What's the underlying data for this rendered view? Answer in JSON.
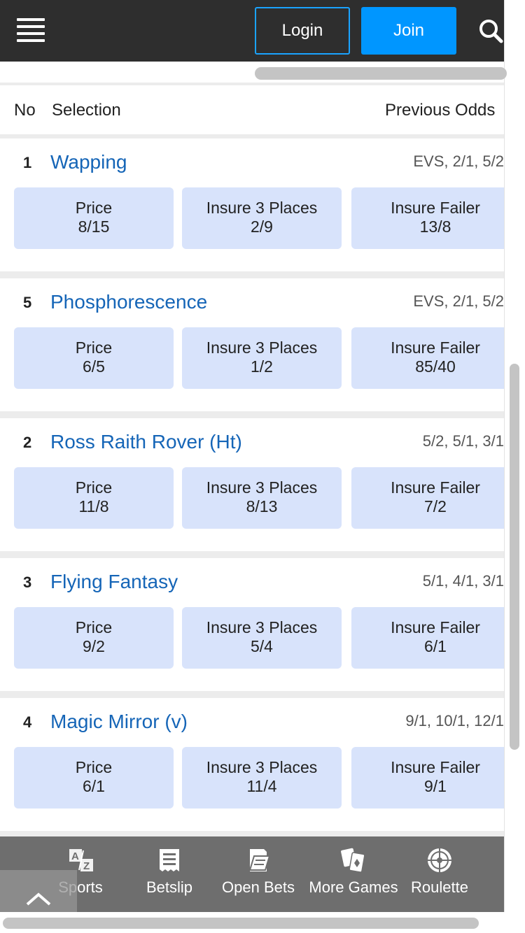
{
  "header": {
    "login_label": "Login",
    "join_label": "Join",
    "icons": {
      "menu": "hamburger-menu-icon",
      "search": "search-icon"
    }
  },
  "columns": {
    "no": "No",
    "selection": "Selection",
    "previous_odds": "Previous Odds"
  },
  "runners": [
    {
      "no": "1",
      "name": "Wapping",
      "previous_odds": "EVS, 2/1, 5/2",
      "price_label": "Price",
      "price": "8/15",
      "insure_places_label": "Insure 3 Places",
      "insure_places": "2/9",
      "insure_failer_label": "Insure Failer",
      "insure_failer": "13/8"
    },
    {
      "no": "5",
      "name": "Phosphorescence",
      "previous_odds": "EVS, 2/1, 5/2",
      "price_label": "Price",
      "price": "6/5",
      "insure_places_label": "Insure 3 Places",
      "insure_places": "1/2",
      "insure_failer_label": "Insure Failer",
      "insure_failer": "85/40"
    },
    {
      "no": "2",
      "name": "Ross Raith Rover (Ht)",
      "previous_odds": "5/2, 5/1, 3/1",
      "price_label": "Price",
      "price": "11/8",
      "insure_places_label": "Insure 3 Places",
      "insure_places": "8/13",
      "insure_failer_label": "Insure Failer",
      "insure_failer": "7/2"
    },
    {
      "no": "3",
      "name": "Flying Fantasy",
      "previous_odds": "5/1, 4/1, 3/1",
      "price_label": "Price",
      "price": "9/2",
      "insure_places_label": "Insure 3 Places",
      "insure_places": "5/4",
      "insure_failer_label": "Insure Failer",
      "insure_failer": "6/1"
    },
    {
      "no": "4",
      "name": "Magic Mirror (v)",
      "previous_odds": "9/1, 10/1, 12/1",
      "price_label": "Price",
      "price": "6/1",
      "insure_places_label": "Insure 3 Places",
      "insure_places": "11/4",
      "insure_failer_label": "Insure Failer",
      "insure_failer": "9/1"
    }
  ],
  "bottom_nav": {
    "sports": "Sports",
    "betslip": "Betslip",
    "open_bets": "Open Bets",
    "more_games": "More Games",
    "roulette": "Roulette"
  },
  "colors": {
    "header_bg": "#2e2e2e",
    "join_bg": "#0096ff",
    "runner_name": "#1565b7",
    "odds_button_bg": "#d8e3fb",
    "bottom_nav_bg": "#6e6e6e"
  }
}
